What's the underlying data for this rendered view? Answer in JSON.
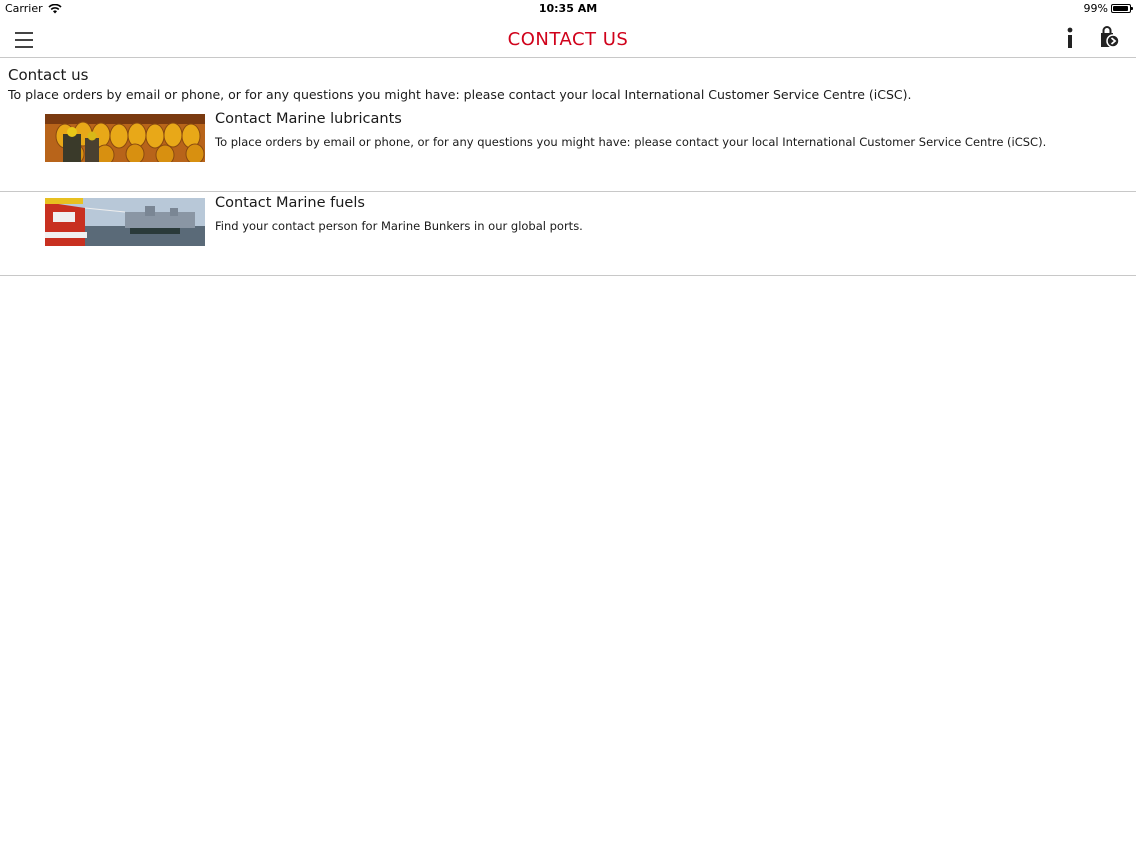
{
  "status_bar": {
    "carrier": "Carrier",
    "time": "10:35 AM",
    "battery_percent": "99%",
    "battery_level": 0.99
  },
  "nav": {
    "title": "CONTACT US",
    "title_color": "#d0021b",
    "menu_icon": "hamburger-menu-icon",
    "info_icon": "info-icon",
    "cart_icon": "cart-icon"
  },
  "intro": {
    "heading": "Contact us",
    "text": "To place orders by email or phone, or for any questions you might have: please contact your local International Customer Service Centre (iCSC)."
  },
  "items": [
    {
      "title": "Contact Marine lubricants",
      "description": "To place orders by email or phone, or for any questions you might have: please contact your local International Customer Service Centre (iCSC).",
      "image": "oil-barrels-image"
    },
    {
      "title": "Contact Marine fuels",
      "description": "Find your contact person for Marine Bunkers in our global ports.",
      "image": "harbour-ship-image"
    }
  ]
}
